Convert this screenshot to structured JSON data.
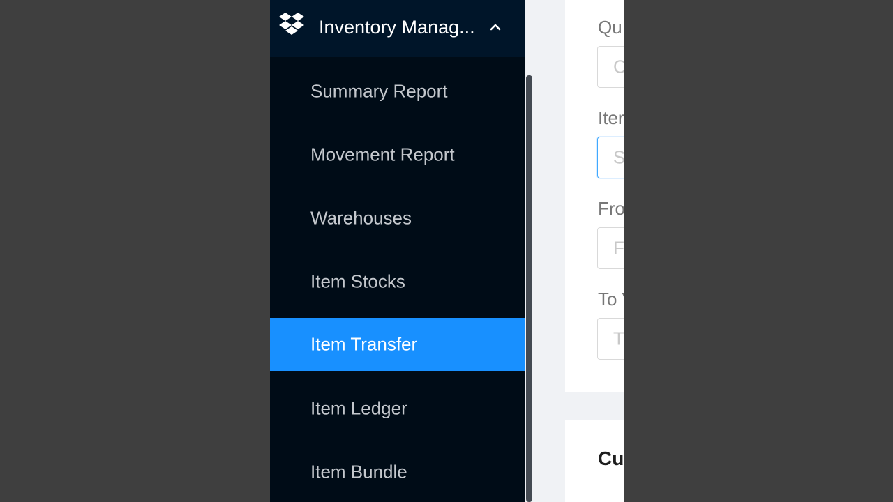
{
  "sidebar": {
    "group_title": "Inventory Manag...",
    "items": [
      {
        "label": "Summary Report"
      },
      {
        "label": "Movement Report"
      },
      {
        "label": "Warehouses"
      },
      {
        "label": "Item Stocks"
      },
      {
        "label": "Item Transfer",
        "selected": true
      },
      {
        "label": "Item Ledger"
      },
      {
        "label": "Item Bundle"
      }
    ]
  },
  "form": {
    "fields": [
      {
        "label": "Qu",
        "placeholder": "C"
      },
      {
        "label": "Iter",
        "placeholder": "S"
      },
      {
        "label": "Fro",
        "placeholder": "F"
      },
      {
        "label": "To V",
        "placeholder": "T"
      }
    ]
  },
  "list_card": {
    "title": "Cu"
  },
  "colors": {
    "sidebar_bg": "#000c17",
    "header_bg": "#001529",
    "selected_bg": "#1890ff",
    "page_bg": "#f0f2f5"
  },
  "icons": {
    "logo": "dropbox-icon",
    "group_toggle": "chevron-up-icon"
  }
}
